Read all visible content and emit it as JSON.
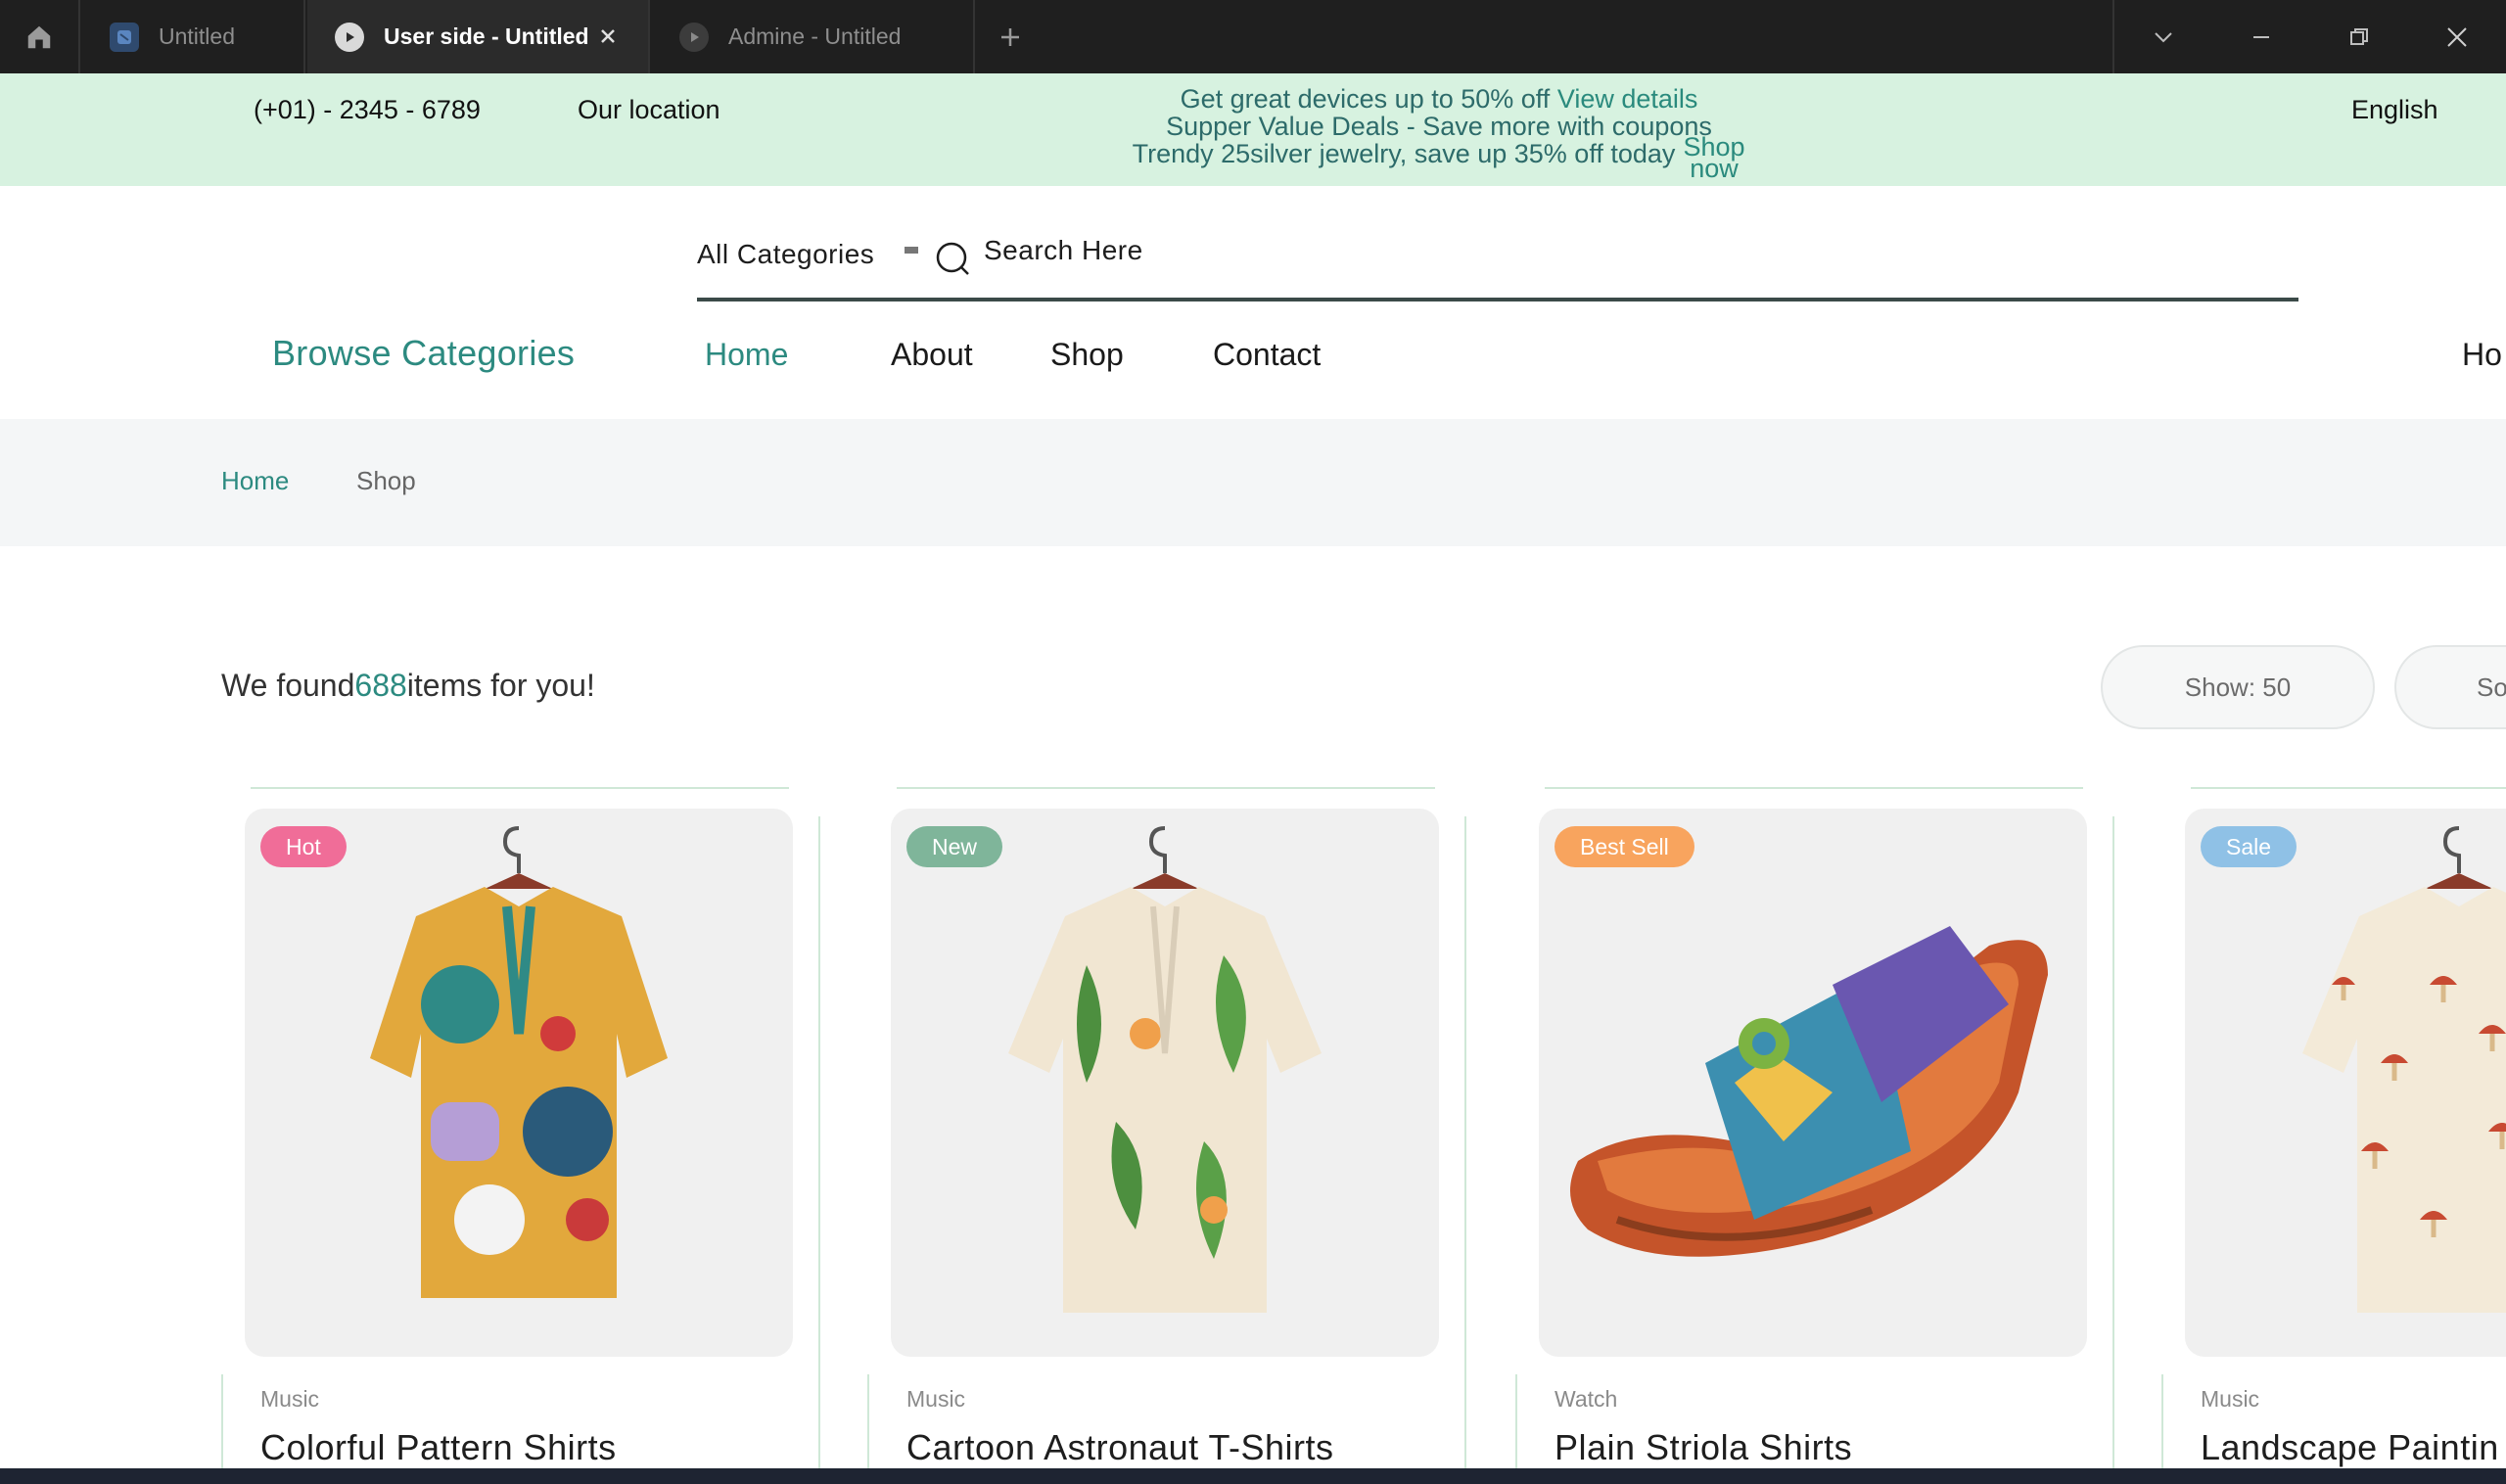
{
  "window": {
    "tabs": [
      {
        "label": "Untitled"
      },
      {
        "label": "User side - Untitled"
      },
      {
        "label": "Admine - Untitled"
      }
    ]
  },
  "promo": {
    "phone": "(+01) - 2345 - 6789",
    "location": "Our location",
    "line1": "Get great devices up to 50% off",
    "line1_link": "View details",
    "line2": "Supper Value Deals - Save more with coupons",
    "line3": "Trendy 25silver jewelry, save up 35% off today",
    "line3_link": "Shop now",
    "language": "English"
  },
  "header": {
    "category_select": "All Categories",
    "search_placeholder": "Search Here",
    "browse_categories": "Browse Categories",
    "nav": [
      "Home",
      "About",
      "Shop",
      "Contact",
      "Ho"
    ]
  },
  "breadcrumb": {
    "home": "Home",
    "current": "Shop"
  },
  "results": {
    "prefix": "We found",
    "count": "688",
    "suffix": "items for you!",
    "show_label": "Show:",
    "show_value": "50",
    "sort_label": "So"
  },
  "products": [
    {
      "badge": "Hot",
      "badge_color": "#f06d98",
      "category": "Music",
      "name": "Colorful Pattern Shirts"
    },
    {
      "badge": "New",
      "badge_color": "#7fb59a",
      "category": "Music",
      "name": "Cartoon Astronaut T-Shirts"
    },
    {
      "badge": "Best Sell",
      "badge_color": "#f8a45e",
      "category": "Watch",
      "name": "Plain Striola Shirts"
    },
    {
      "badge": "Sale",
      "badge_color": "#8fc1e6",
      "category": "Music",
      "name": "Landscape Paintin"
    }
  ],
  "colors": {
    "accent": "#2c8a80",
    "promo_bg": "#d7f2e0"
  }
}
